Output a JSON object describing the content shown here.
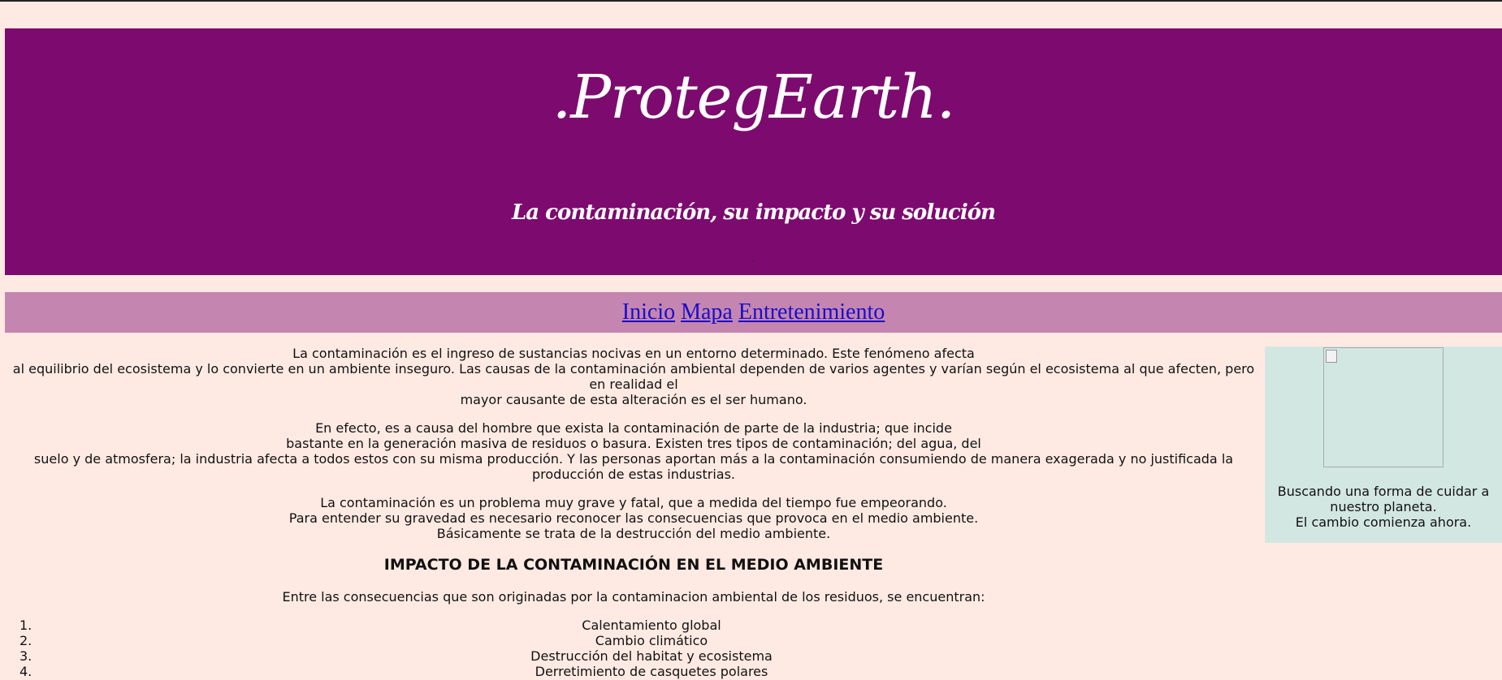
{
  "header": {
    "title": ".ProtegEarth.",
    "subtitle": "La contaminación, su impacto y su solución",
    "dot": "."
  },
  "nav": {
    "links": [
      "Inicio",
      "Mapa",
      "Entretenimiento"
    ]
  },
  "main": {
    "p1": [
      "La contaminación es el ingreso de sustancias nocivas en un entorno determinado. Este fenómeno afecta",
      "al equilibrio del ecosistema y lo convierte en un ambiente inseguro. Las causas de la contaminación ambiental dependen de varios agentes y varían según el ecosistema al que afecten, pero en realidad el",
      "mayor causante de esta alteración es el ser humano."
    ],
    "p2": [
      "En efecto, es a causa del hombre que exista la contaminación de parte de la industria; que incide",
      "bastante en la generación masiva de residuos o basura. Existen tres tipos de contaminación; del agua, del",
      "suelo y de atmosfera; la industria afecta a todos estos con su misma producción. Y las personas aportan más a la contaminación consumiendo de manera exagerada y no justificada la producción de estas industrias."
    ],
    "p3": [
      "La contaminación es un problema muy grave y fatal, que a medida del tiempo fue empeorando.",
      "Para entender su gravedad es necesario reconocer las consecuencias que provoca en el medio ambiente.",
      "Básicamente se trata de la destrucción del medio ambiente."
    ],
    "heading": "IMPACTO DE LA CONTAMINACIÓN EN EL MEDIO AMBIENTE",
    "intro": "Entre las consecuencias que son originadas por la contaminacion ambiental de los residuos, se encuentran:",
    "list": [
      {
        "num": "1.",
        "text": "Calentamiento global"
      },
      {
        "num": "2.",
        "text": "Cambio climático"
      },
      {
        "num": "3.",
        "text": "Destrucción del habitat y ecosistema"
      },
      {
        "num": "4.",
        "text": "Derretimiento de casquetes polares"
      }
    ]
  },
  "aside": {
    "line1": "Buscando una forma de cuidar a nuestro planeta.",
    "line2": "El cambio comienza ahora."
  }
}
